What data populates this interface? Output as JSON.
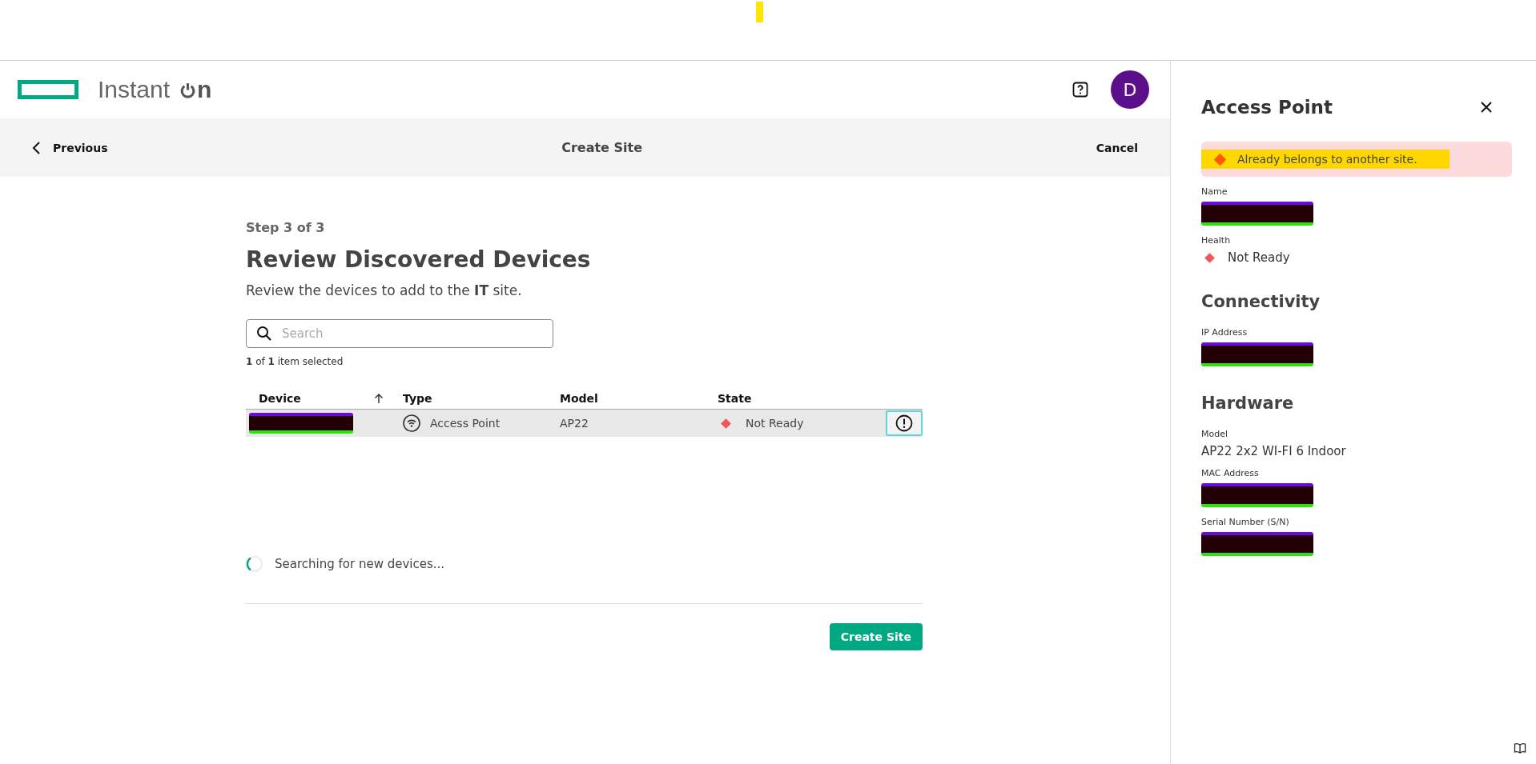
{
  "header": {
    "logo_text": "Instant",
    "logo_suffix": "n",
    "avatar": "D"
  },
  "nav": {
    "previous": "Previous",
    "title": "Create Site",
    "cancel": "Cancel"
  },
  "step": "Step 3 of 3",
  "heading": "Review Discovered Devices",
  "subtitle": "Review the devices to add to the **IT** site.",
  "search": {
    "placeholder": "Search"
  },
  "selection": "**1** of **1** item selected",
  "table": {
    "columns": [
      {
        "label": "Device",
        "sorted": true
      },
      {
        "label": "Type",
        "sorted": false
      },
      {
        "label": "Model",
        "sorted": false
      },
      {
        "label": "State",
        "sorted": false
      }
    ],
    "rows": [
      {
        "selected": true,
        "type": "Access Point",
        "model": "AP22",
        "state": "Not Ready",
        "color": "#f0575b"
      }
    ]
  },
  "searching": "Searching for new devices...",
  "create_button": "Create Site",
  "panel": {
    "title": "Access Point",
    "alert": "Already belongs to another site.",
    "items": [
      {
        "kind": "redacted",
        "label": "Name"
      },
      {
        "kind": "status",
        "label": "Health",
        "value": "Not Ready",
        "color": "#f0575b"
      },
      {
        "kind": "heading",
        "label": "Connectivity"
      },
      {
        "kind": "redacted",
        "label": "IP Address"
      },
      {
        "kind": "heading",
        "label": "Hardware"
      },
      {
        "kind": "text",
        "label": "Model",
        "value": "AP22 2x2 WI-FI 6 Indoor"
      },
      {
        "kind": "redacted",
        "label": "MAC Address"
      },
      {
        "kind": "redacted",
        "label": "Serial Number (S/N)"
      }
    ]
  }
}
